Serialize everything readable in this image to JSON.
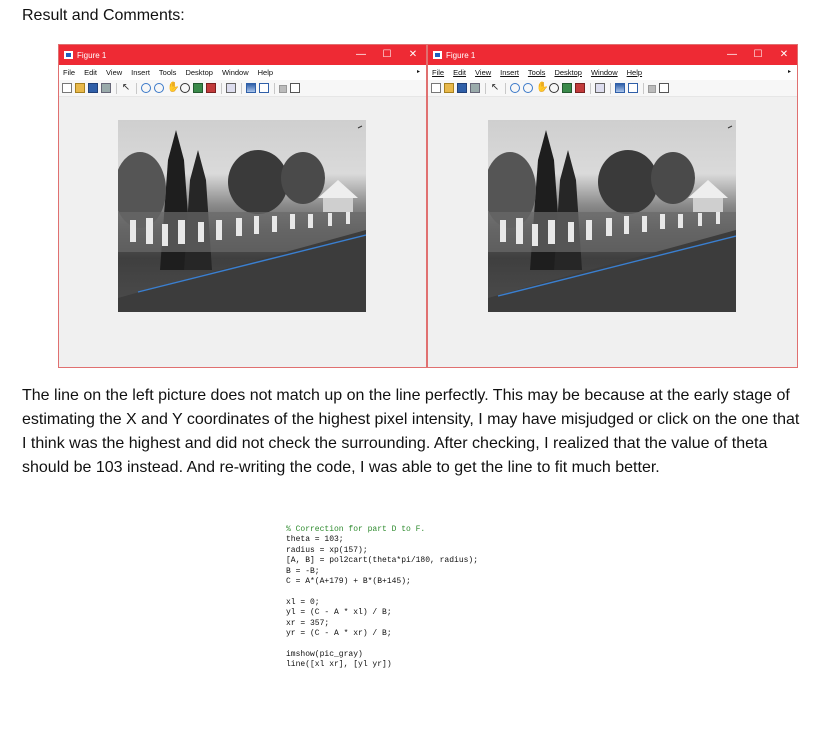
{
  "heading": "Result and Comments:",
  "figure_left": {
    "title": "Figure 1",
    "menu": [
      "File",
      "Edit",
      "View",
      "Insert",
      "Tools",
      "Desktop",
      "Window",
      "Help"
    ]
  },
  "figure_right": {
    "title": "Figure 1",
    "menu": [
      "File",
      "Edit",
      "View",
      "Insert",
      "Tools",
      "Desktop",
      "Window",
      "Help"
    ]
  },
  "window_controls": {
    "minimize": "—",
    "maximize": "☐",
    "close": "✕",
    "menu_more": "▸"
  },
  "toolbar_icons": [
    "new-figure-icon",
    "open-file-icon",
    "save-icon",
    "print-icon",
    "arrow-select-icon",
    "zoom-in-icon",
    "zoom-out-icon",
    "pan-icon",
    "rotate-3d-icon",
    "data-cursor-icon",
    "brush-icon",
    "link-plot-icon",
    "insert-colorbar-icon",
    "insert-legend-icon",
    "hide-plot-tools-icon",
    "show-plot-tools-icon"
  ],
  "colors": {
    "titlebar": "#ee2a34",
    "fitted_line": "#3a7fd0"
  },
  "paragraph": "The line on the left picture does not match up on the line perfectly. This may be because at the early stage of estimating the X and Y coordinates of the highest pixel intensity, I may have misjudged or click on the one that I think was the highest and did not check the surrounding. After checking, I realized that the value of theta should be 103 instead. And re-writing the code, I was able to get the line to fit much better.",
  "code": {
    "comment": "% Correction for part D to F.",
    "lines": [
      "theta = 103;",
      "radius = xp(157);",
      "[A, B] = pol2cart(theta*pi/180, radius);",
      "B = -B;",
      "C = A*(A+179) + B*(B+145);",
      "",
      "xl = 0;",
      "yl = (C - A * xl) / B;",
      "xr = 357;",
      "yr = (C - A * xr) / B;",
      "",
      "imshow(pic_gray)",
      "line([xl xr], [yl yr])"
    ]
  }
}
